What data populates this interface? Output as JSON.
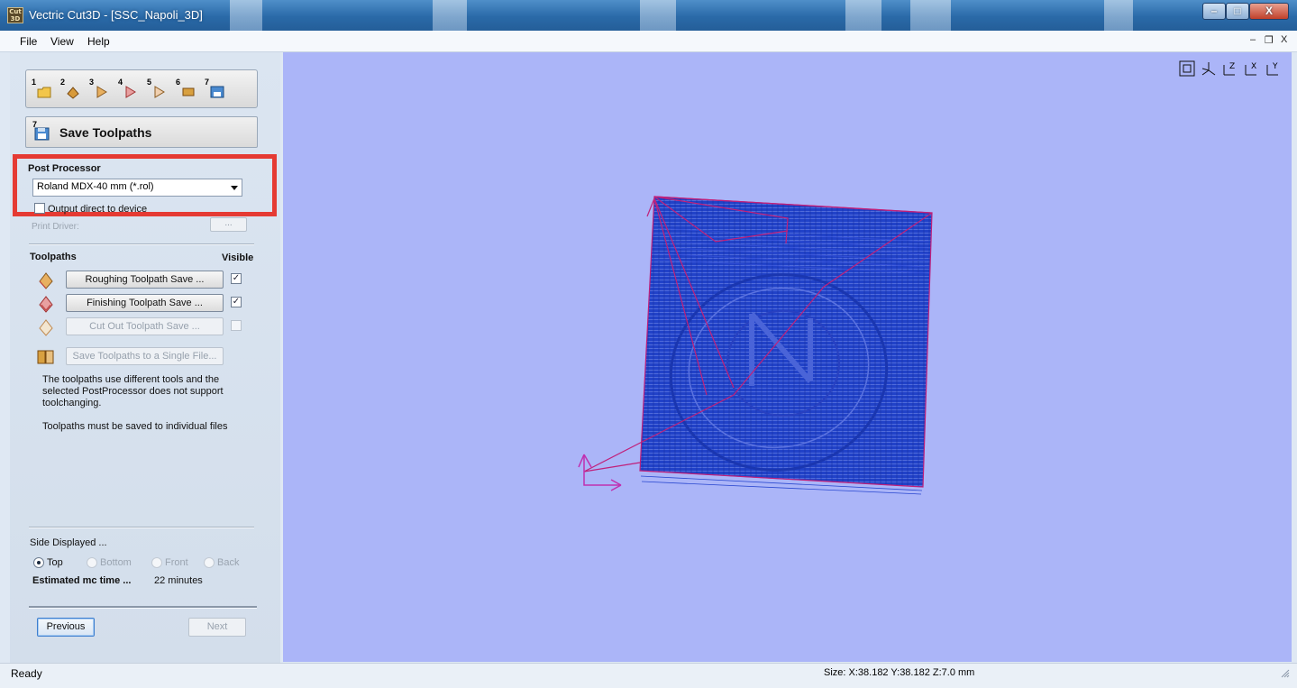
{
  "window": {
    "title": "Vectric Cut3D - [SSC_Napoli_3D]",
    "app_icon_text": "Cut 3D",
    "minimize": "–",
    "maximize": "□",
    "close": "X"
  },
  "menu": {
    "items": [
      {
        "label": "File"
      },
      {
        "label": "View"
      },
      {
        "label": "Help"
      }
    ],
    "mdi_minimize": "–",
    "mdi_restore": "❐",
    "mdi_close": "X"
  },
  "steps": {
    "numbers": [
      "1",
      "2",
      "3",
      "4",
      "5",
      "6",
      "7"
    ]
  },
  "save_panel": {
    "title": "Save Toolpaths",
    "title_icon_number": "7",
    "post_processor_label": "Post Processor",
    "post_processor_value": "Roland MDX-40 mm (*.rol)",
    "output_direct_label": "Output direct to device",
    "print_driver_label": "Print Driver:",
    "browse_label": "..."
  },
  "toolpaths": {
    "header": "Toolpaths",
    "visible_header": "Visible",
    "items": [
      {
        "label": "Roughing Toolpath Save ...",
        "visible": true,
        "enabled": true
      },
      {
        "label": "Finishing Toolpath Save ...",
        "visible": true,
        "enabled": true
      },
      {
        "label": "Cut Out Toolpath Save ...",
        "visible": false,
        "enabled": false
      }
    ],
    "single_file_label": "Save Toolpaths to a Single File...",
    "info_text": "The toolpaths use different tools and the selected PostProcessor does not support toolchanging.",
    "info_text_2": "Toolpaths must be saved to individual files"
  },
  "side": {
    "label": "Side Displayed ...",
    "options": [
      "Top",
      "Bottom",
      "Front",
      "Back"
    ],
    "selected": "Top",
    "time_label": "Estimated mc time ...",
    "time_value": "22 minutes"
  },
  "nav": {
    "previous": "Previous",
    "next": "Next"
  },
  "viewport": {
    "background": "#abb5f8",
    "toolpath_color": "#1838c8",
    "boundary_color": "#c0207a",
    "view_icons": [
      "zoom-extents-icon",
      "iso-view-icon",
      "z-view-icon",
      "x-view-icon",
      "y-view-icon"
    ]
  },
  "status": {
    "left": "Ready",
    "size": "Size: X:38.182 Y:38.182 Z:7.0 mm"
  }
}
